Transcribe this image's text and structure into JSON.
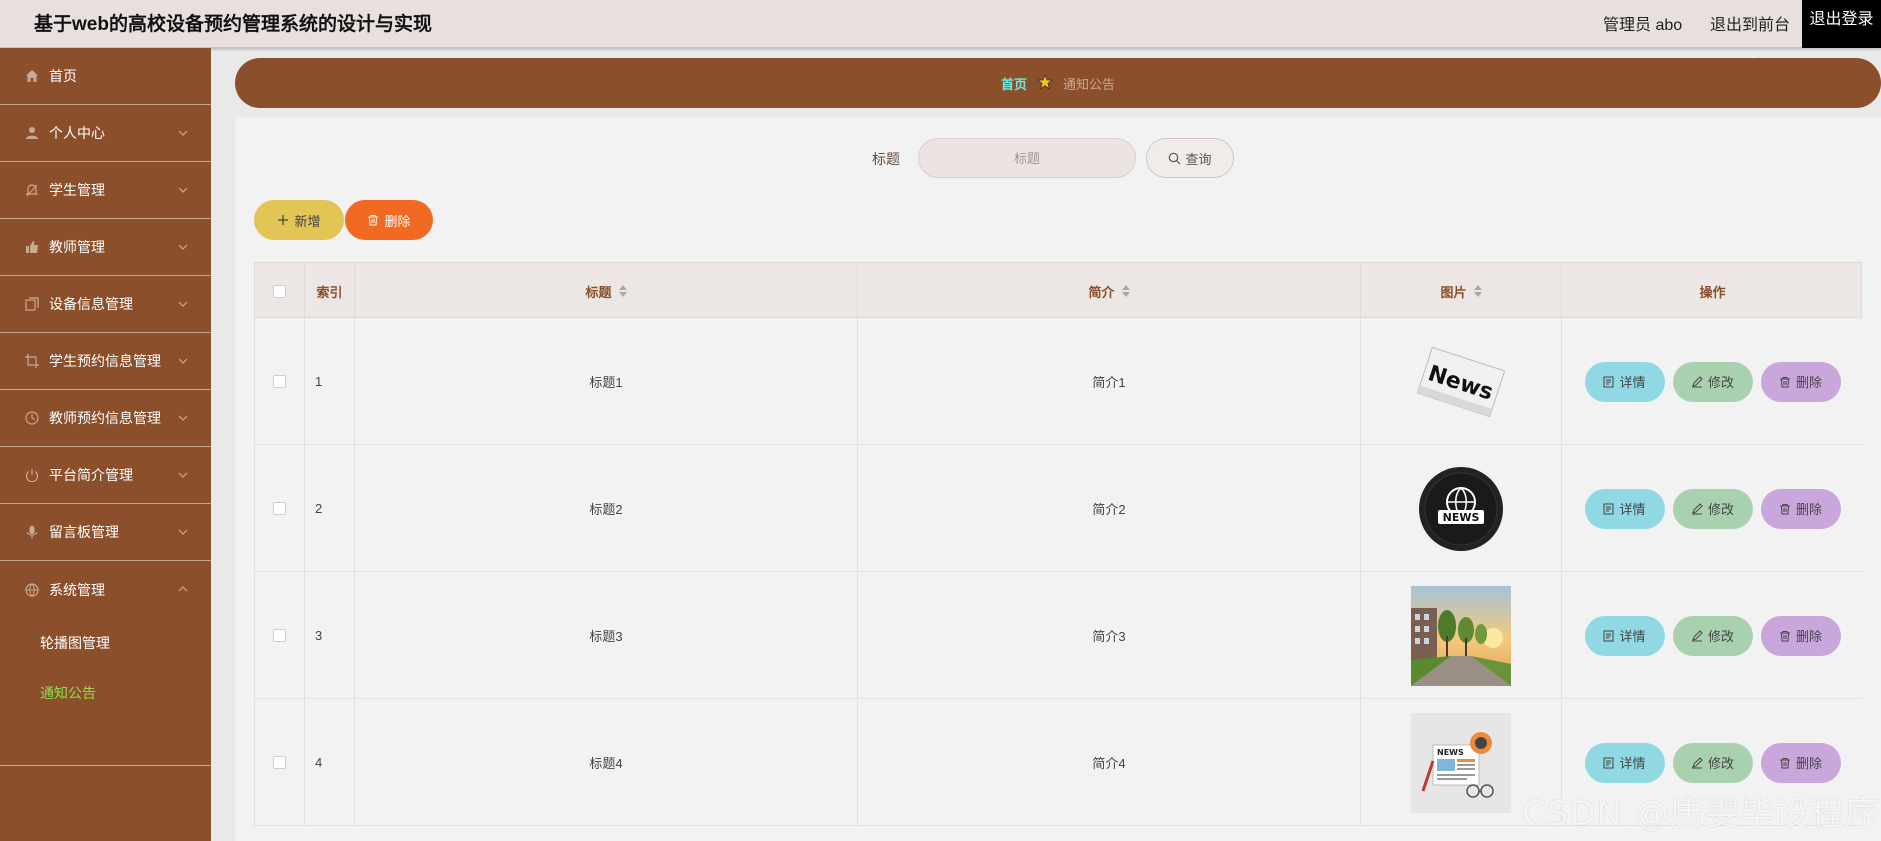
{
  "header": {
    "app_title": "基于web的高校设备预约管理系统的设计与实现",
    "user_label": "管理员 abo",
    "goto_front": "退出到前台",
    "logout": "退出登录"
  },
  "sidebar": {
    "items": [
      {
        "label": "首页",
        "icon": "home-icon"
      },
      {
        "label": "个人中心",
        "icon": "user-icon"
      },
      {
        "label": "学生管理",
        "icon": "bell-icon"
      },
      {
        "label": "教师管理",
        "icon": "thumb-icon"
      },
      {
        "label": "设备信息管理",
        "icon": "copy-icon"
      },
      {
        "label": "学生预约信息管理",
        "icon": "crop-icon"
      },
      {
        "label": "教师预约信息管理",
        "icon": "clock-icon"
      },
      {
        "label": "平台简介管理",
        "icon": "power-icon"
      },
      {
        "label": "留言板管理",
        "icon": "mic-icon"
      },
      {
        "label": "系统管理",
        "icon": "globe-icon"
      }
    ],
    "sub_items": [
      {
        "label": "轮播图管理"
      },
      {
        "label": "通知公告"
      }
    ]
  },
  "breadcrumb": {
    "home": "首页",
    "current": "通知公告"
  },
  "search": {
    "label": "标题",
    "placeholder": "标题",
    "query_button": "查询"
  },
  "toolbar": {
    "add_label": "新增",
    "delete_label": "删除"
  },
  "table": {
    "columns": [
      "索引",
      "标题",
      "简介",
      "图片",
      "操作"
    ],
    "rows": [
      {
        "index": "1",
        "title": "标题1",
        "intro": "简介1",
        "image": "news-paper"
      },
      {
        "index": "2",
        "title": "标题2",
        "intro": "简介2",
        "image": "news-globe"
      },
      {
        "index": "3",
        "title": "标题3",
        "intro": "简介3",
        "image": "campus-photo"
      },
      {
        "index": "4",
        "title": "标题4",
        "intro": "简介4",
        "image": "news-desk"
      }
    ],
    "actions": {
      "detail": "详情",
      "edit": "修改",
      "delete": "删除"
    }
  },
  "watermark": "CSDN @唐雯毕设程序",
  "colors": {
    "sidebar_bg": "#8b4f2b",
    "breadcrumb_active": "#6ee8e0",
    "add_button": "#e3c555",
    "delete_button": "#f26a22",
    "detail_button": "#8fd8e4",
    "edit_button": "#a9d1b0",
    "row_delete_button": "#c9a6dc",
    "active_sub_item": "#8ee04a"
  }
}
